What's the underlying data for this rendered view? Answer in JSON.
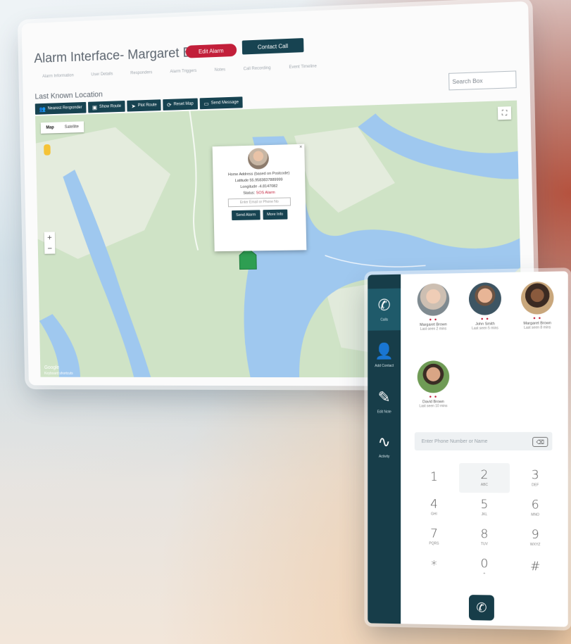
{
  "alarm": {
    "title": "Alarm Interface- Margaret Brown",
    "red_button": "Edit Alarm",
    "teal_button": "Contact Call",
    "tabs": [
      "Alarm Information",
      "User Details",
      "Responders",
      "Alarm Triggers",
      "Notes",
      "Call Recording",
      "Event Timeline"
    ],
    "section_title": "Last Known Location",
    "search_placeholder": "Search Box",
    "toolbar": [
      {
        "icon": "👥",
        "label": "Nearest Responder"
      },
      {
        "icon": "▣",
        "label": "Show Route"
      },
      {
        "icon": "➤",
        "label": "Plot Route"
      },
      {
        "icon": "⟳",
        "label": "Reset Map"
      },
      {
        "icon": "▭",
        "label": "Send Message"
      }
    ],
    "map": {
      "types": [
        "Map",
        "Satellite"
      ],
      "fullscreen_icon": "⛶",
      "zoom_in": "+",
      "zoom_out": "−",
      "logo": "Google",
      "attribution": "Keyboard shortcuts"
    },
    "info": {
      "close": "×",
      "home_address": "Home Address (based on Postcode)",
      "latitude": "Latitude 55.9583837889999",
      "longitude": "Longitude -4.8147082",
      "status_label": "Status:",
      "status_value": "SOS Alarm",
      "input_placeholder": "Enter Email or Phone No",
      "btn_send": "Send Alarm",
      "btn_more": "More Info"
    }
  },
  "phone": {
    "sidebar": [
      {
        "icon": "✆",
        "label": "Calls"
      },
      {
        "icon": "👤",
        "label": "Add Contact"
      },
      {
        "icon": "✎",
        "label": "Edit Note"
      },
      {
        "icon": "∿",
        "label": "Activity"
      }
    ],
    "contacts": [
      {
        "name": "Margaret Brown",
        "sub": "Last seen 2 mins",
        "dots": "● ●"
      },
      {
        "name": "John Smith",
        "sub": "Last seen 5 mins",
        "dots": "● ●"
      },
      {
        "name": "Margaret Brown",
        "sub": "Last seen 8 mins",
        "dots": "● ●"
      },
      {
        "name": "David Brown",
        "sub": "Last seen 10 mins",
        "dots": "● ●"
      }
    ],
    "dial_placeholder": "Enter Phone Number or Name",
    "backspace_icon": "⌫",
    "keys": [
      {
        "digit": "1",
        "letters": ""
      },
      {
        "digit": "2",
        "letters": "ABC"
      },
      {
        "digit": "3",
        "letters": "DEF"
      },
      {
        "digit": "4",
        "letters": "GHI"
      },
      {
        "digit": "5",
        "letters": "JKL"
      },
      {
        "digit": "6",
        "letters": "MNO"
      },
      {
        "digit": "7",
        "letters": "PQRS"
      },
      {
        "digit": "8",
        "letters": "TUV"
      },
      {
        "digit": "9",
        "letters": "WXYZ"
      },
      {
        "digit": "*",
        "letters": ""
      },
      {
        "digit": "0",
        "letters": "+"
      },
      {
        "digit": "#",
        "letters": ""
      }
    ],
    "call_icon": "✆"
  },
  "colors": {
    "accent": "#174351",
    "alert": "#c21f3a",
    "water": "#9fc8ef",
    "land": "#c8dfc4"
  }
}
